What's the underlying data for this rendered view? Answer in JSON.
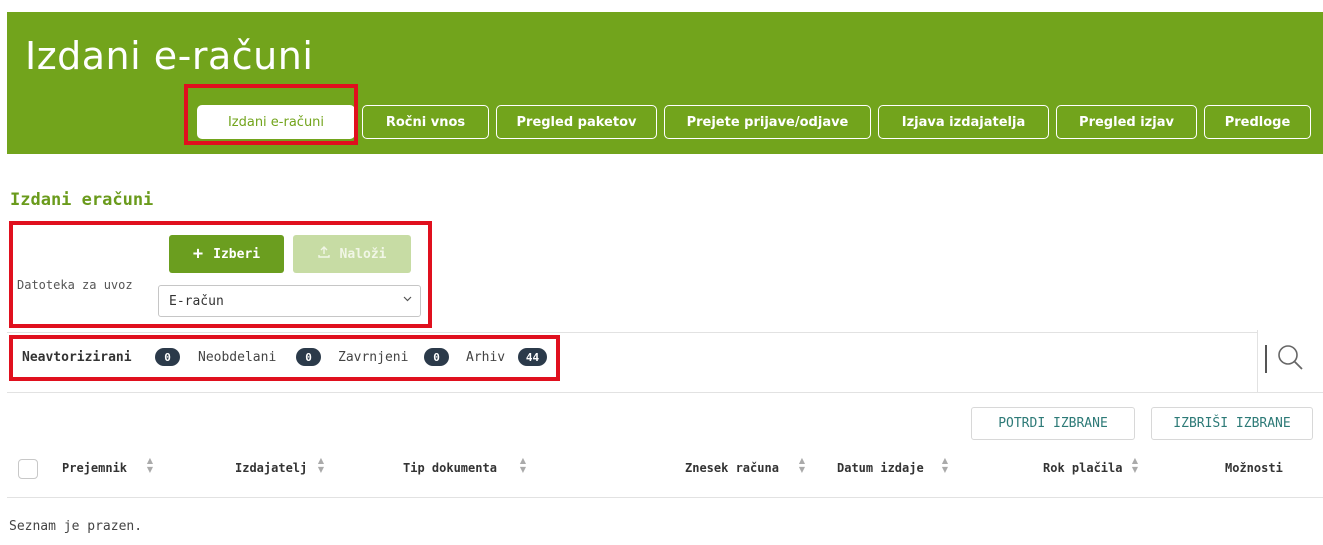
{
  "header": {
    "title": "Izdani e-računi"
  },
  "tabs": [
    {
      "label": "Izdani e-računi",
      "active": true
    },
    {
      "label": "Ročni vnos"
    },
    {
      "label": "Pregled paketov"
    },
    {
      "label": "Prejete prijave/odjave"
    },
    {
      "label": "Izjava izdajatelja"
    },
    {
      "label": "Pregled izjav"
    },
    {
      "label": "Predloge"
    }
  ],
  "section": {
    "title": "Izdani eračuni"
  },
  "upload": {
    "label": "Datoteka za uvoz",
    "select_label": "+",
    "select_button": "Izberi",
    "upload_icon": "upload-icon",
    "upload_button": "Naloži",
    "file_type": "E-račun"
  },
  "filters": [
    {
      "label": "Neavtorizirani",
      "count": "0"
    },
    {
      "label": "Neobdelani",
      "count": "0"
    },
    {
      "label": "Zavrnjeni",
      "count": "0"
    },
    {
      "label": "Arhiv",
      "count": "44"
    }
  ],
  "actions": {
    "confirm": "POTRDI IZBRANE",
    "delete": "IZBRIŠI IZBRANE"
  },
  "table": {
    "columns": [
      "Prejemnik",
      "Izdajatelj",
      "Tip dokumenta",
      "Znesek računa",
      "Datum izdaje",
      "Rok plačila",
      "Možnosti"
    ],
    "empty_text": "Seznam je prazen."
  },
  "colors": {
    "header": "#72a41c",
    "highlight": "#e0101e",
    "badge": "#2b3a4a",
    "accent_text": "#2d7a77"
  }
}
